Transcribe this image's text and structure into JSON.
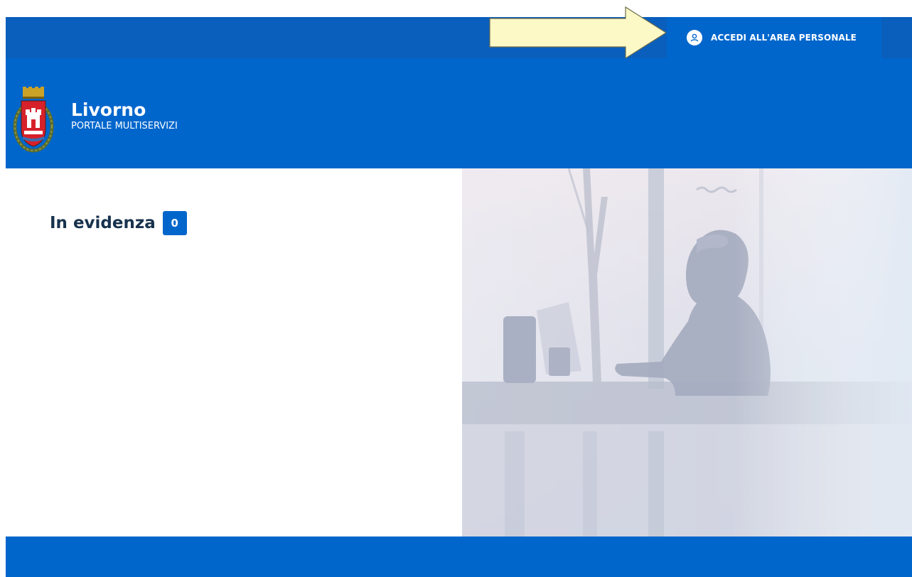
{
  "topbar": {
    "login_label": "ACCEDI ALL'AREA PERSONALE",
    "login_icon": "user-icon"
  },
  "header": {
    "title": "Livorno",
    "subtitle": "PORTALE MULTISERVIZI"
  },
  "main": {
    "section_title": "In evidenza",
    "section_count": "0"
  },
  "colors": {
    "primary": "#0066cc",
    "topbar": "#0a5fbd",
    "title_text": "#17324d",
    "annotation": "#fdf9c7"
  }
}
